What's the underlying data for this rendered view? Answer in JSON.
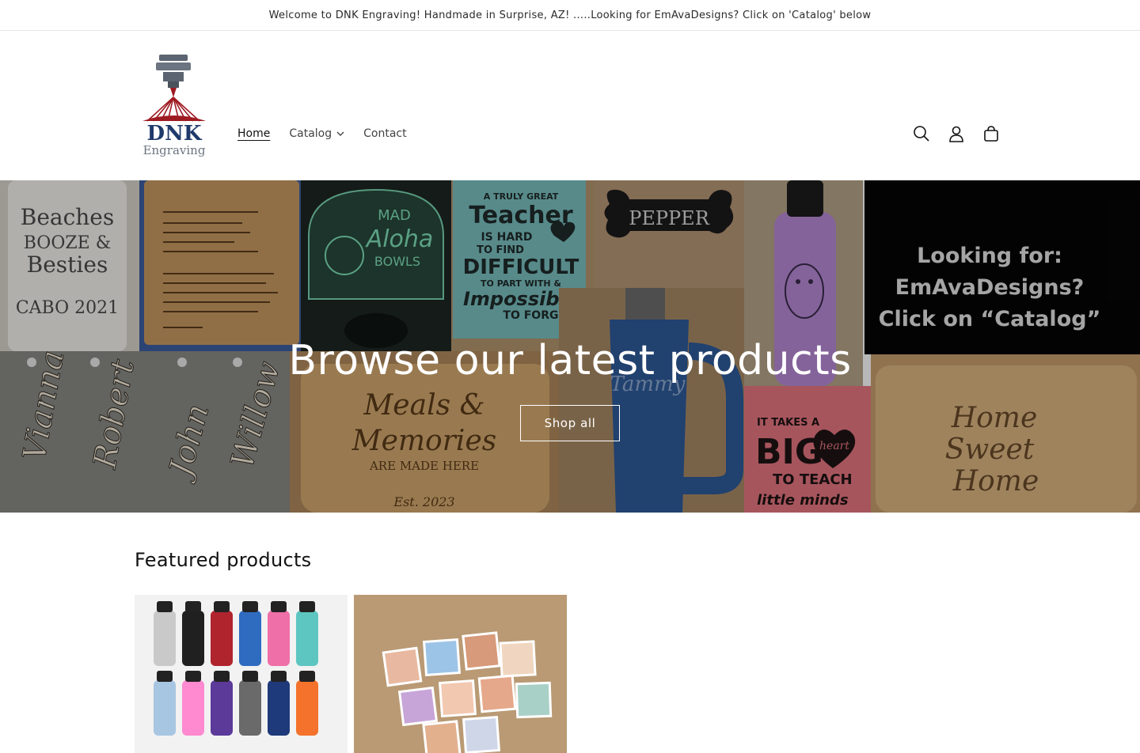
{
  "announcement": {
    "text": "Welcome to DNK Engraving! Handmade in Surprise, AZ! .....Looking for EmAvaDesigns? Click on 'Catalog' below"
  },
  "header": {
    "logo_text_main": "DNK",
    "logo_text_sub": "Engraving",
    "nav": [
      {
        "label": "Home",
        "active": true
      },
      {
        "label": "Catalog",
        "has_dropdown": true
      },
      {
        "label": "Contact"
      }
    ],
    "icons": [
      "search-icon",
      "account-icon",
      "cart-icon"
    ]
  },
  "hero": {
    "title": "Browse our latest products",
    "button_label": "Shop all",
    "panels": {
      "cup_text_1": "Beaches",
      "cup_text_2": "BOOZE &",
      "cup_text_3": "Besties",
      "cup_text_4": "CABO 2021",
      "sign_text_1": "MAD",
      "sign_text_2": "Aloha",
      "sign_text_3": "BOWLS",
      "teacher_1": "A TRULY GREAT",
      "teacher_2": "Teacher",
      "teacher_3": "IS HARD",
      "teacher_4": "TO FIND",
      "teacher_5": "DIFFICULT",
      "teacher_6": "TO PART WITH &",
      "teacher_7": "Impossible",
      "teacher_8": "TO FORGET",
      "tag_text": "PEPPER",
      "promo_1": "Looking for:",
      "promo_2": "EmAvaDesigns?",
      "promo_3": "Click on “Catalog”",
      "names": [
        "Vianna",
        "Robert",
        "John",
        "Willow"
      ],
      "board_1": "Meals &",
      "board_2": "Memories",
      "board_3": "ARE MADE HERE",
      "board_4": "Est. 2023",
      "tumbler_text": "Tammy",
      "big_heart_1": "IT TAKES A",
      "big_heart_2": "BIG",
      "big_heart_3": "heart",
      "big_heart_4": "TO TEACH",
      "big_heart_5": "little minds",
      "home_1": "Home",
      "home_2": "Sweet",
      "home_3": "Home"
    }
  },
  "featured": {
    "heading": "Featured products"
  },
  "colors": {
    "accent_red": "#9e1b22",
    "logo_blue": "#1f3a6b",
    "bottle_blue": "#2e5b9a",
    "bottle_purple": "#b78ad6",
    "leather_pink": "#e87782",
    "leather_teal": "#6fb7b9"
  }
}
